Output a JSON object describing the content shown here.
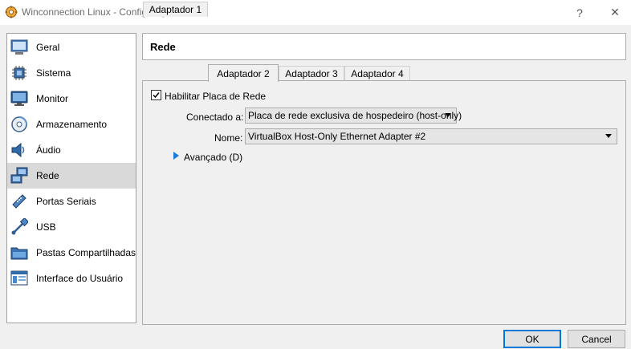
{
  "window": {
    "title": "Winconnection Linux - Configurações",
    "help_label": "?",
    "close_label": "✕"
  },
  "sidebar": {
    "items": [
      {
        "label": "Geral",
        "icon": "general-icon"
      },
      {
        "label": "Sistema",
        "icon": "system-chip-icon"
      },
      {
        "label": "Monitor",
        "icon": "monitor-icon"
      },
      {
        "label": "Armazenamento",
        "icon": "storage-icon"
      },
      {
        "label": "Áudio",
        "icon": "speaker-icon"
      },
      {
        "label": "Rede",
        "icon": "network-icon",
        "selected": true
      },
      {
        "label": "Portas Seriais",
        "icon": "serial-port-icon"
      },
      {
        "label": "USB",
        "icon": "usb-icon"
      },
      {
        "label": "Pastas Compartilhadas",
        "icon": "shared-folder-icon"
      },
      {
        "label": "Interface do Usuário",
        "icon": "user-interface-icon"
      }
    ]
  },
  "header": {
    "title": "Rede"
  },
  "tabs": [
    {
      "label": "Adaptador 1"
    },
    {
      "label": "Adaptador 2",
      "active": true
    },
    {
      "label": "Adaptador 3"
    },
    {
      "label": "Adaptador 4"
    }
  ],
  "adapter": {
    "enable_label": "Habilitar Placa de Rede",
    "enabled": true,
    "attached_label": "Conectado a:",
    "attached_value": "Placa de rede exclusiva de hospedeiro (host-only)",
    "name_label": "Nome:",
    "name_value": "VirtualBox Host-Only Ethernet Adapter #2",
    "advanced_label": "Avançado (D)"
  },
  "buttons": {
    "ok": "OK",
    "cancel": "Cancel"
  },
  "colors": {
    "selection": "#d9d9d9",
    "accent": "#0078d7",
    "expander": "#1c7bd8"
  }
}
